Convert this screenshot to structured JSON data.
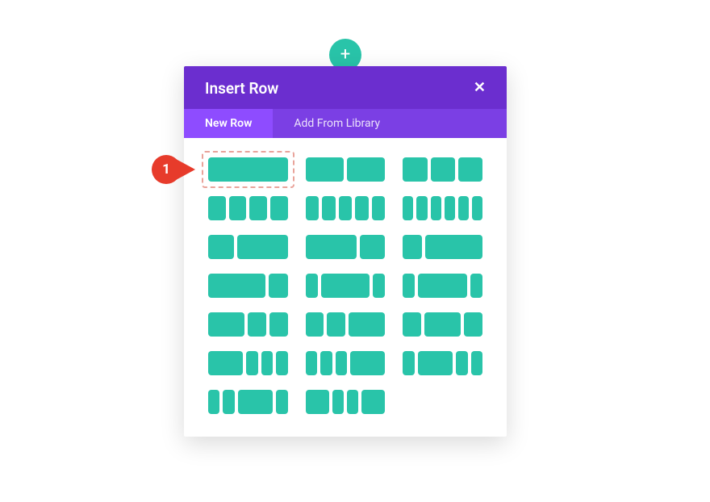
{
  "colors": {
    "teal": "#29c4a9",
    "purple_dark": "#6b2ecf",
    "purple": "#7b3fe4",
    "purple_light": "#8e4cff",
    "pointer": "#e73b2b",
    "selection": "#e9a39a"
  },
  "add_button": {
    "glyph": "+"
  },
  "modal": {
    "title": "Insert Row",
    "close_glyph": "✕",
    "tabs": {
      "new_row": "New Row",
      "add_from_library": "Add From Library",
      "active": "new_row"
    },
    "layouts": [
      {
        "id": "full",
        "cols": [
          1
        ]
      },
      {
        "id": "half-half",
        "cols": [
          1,
          1
        ]
      },
      {
        "id": "thirds",
        "cols": [
          1,
          1,
          1
        ]
      },
      {
        "id": "quarters",
        "cols": [
          1,
          1,
          1,
          1
        ]
      },
      {
        "id": "fifths",
        "cols": [
          1,
          1,
          1,
          1,
          1
        ]
      },
      {
        "id": "sixths",
        "cols": [
          1,
          1,
          1,
          1,
          1,
          1
        ]
      },
      {
        "id": "1-2",
        "cols": [
          1,
          2
        ]
      },
      {
        "id": "2-1",
        "cols": [
          2,
          1
        ]
      },
      {
        "id": "1-3",
        "cols": [
          1,
          3
        ]
      },
      {
        "id": "3-1",
        "cols": [
          3,
          1
        ]
      },
      {
        "id": "1-4-1",
        "cols": [
          1,
          4,
          1
        ]
      },
      {
        "id": "1-2-1",
        "cols": [
          1,
          4,
          1
        ]
      },
      {
        "id": "2-1-1",
        "cols": [
          2,
          1,
          1
        ]
      },
      {
        "id": "1-1-2",
        "cols": [
          1,
          1,
          2
        ]
      },
      {
        "id": "1-2-1b",
        "cols": [
          1,
          2,
          1
        ]
      },
      {
        "id": "3-1-1-1",
        "cols": [
          3,
          1,
          1,
          1
        ]
      },
      {
        "id": "1-1-1-3",
        "cols": [
          1,
          1,
          1,
          3
        ]
      },
      {
        "id": "1-3-1-1",
        "cols": [
          1,
          3,
          1,
          1
        ]
      },
      {
        "id": "1-1-3-1",
        "cols": [
          1,
          1,
          3,
          1
        ]
      },
      {
        "id": "2-1-1-2",
        "cols": [
          2,
          1,
          1,
          2
        ]
      }
    ]
  },
  "annotation": {
    "label": "1",
    "target_layout_index": 0
  }
}
